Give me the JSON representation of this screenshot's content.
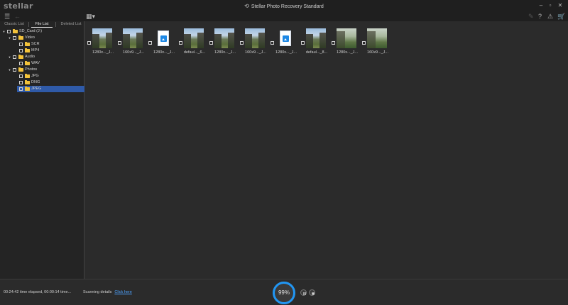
{
  "app": {
    "logo_text": "stellar",
    "window_title": "Stellar Photo Recovery Standard"
  },
  "toolbar": {
    "icons": [
      "menu-icon",
      "back-icon",
      "view-toggle-icon",
      "edit-icon",
      "help-icon",
      "warning-icon",
      "cart-icon"
    ]
  },
  "tabs": [
    {
      "label": "Classic List",
      "active": false
    },
    {
      "label": "File List",
      "active": true
    },
    {
      "label": "Deleted List",
      "active": false
    }
  ],
  "tree": [
    {
      "label": "SD_Card (J:)",
      "expanded": true
    },
    {
      "label": "Video",
      "expanded": true
    },
    {
      "label": "SCR"
    },
    {
      "label": "MP4"
    },
    {
      "label": "Audio",
      "expanded": true
    },
    {
      "label": "WAV"
    },
    {
      "label": "Photos",
      "expanded": true
    },
    {
      "label": "JPG"
    },
    {
      "label": "DNG"
    },
    {
      "label": "JPEG",
      "selected": true
    }
  ],
  "files": [
    {
      "name": "1280x..._J..."
    },
    {
      "name": "160x9..._J..."
    },
    {
      "name": "1280x..._J..."
    },
    {
      "name": "defaul..._6..."
    },
    {
      "name": "1280x..._J..."
    },
    {
      "name": "160x9..._J..."
    },
    {
      "name": "1280x..._J..."
    },
    {
      "name": "defaul..._8..."
    },
    {
      "name": "1280x..._J..."
    },
    {
      "name": "160x9..._J..."
    }
  ],
  "status": {
    "elapsed": "00:24:42 time elapsed, 00:00:14 time...",
    "scanning_label": "Scanning details",
    "click_here": "Click here",
    "progress_text": "99%",
    "progress_value": 0.99
  },
  "colors": {
    "accent": "#2196f3",
    "selection": "#2f5aa8",
    "link": "#4ea3ff",
    "folder": "#f2c23a"
  }
}
